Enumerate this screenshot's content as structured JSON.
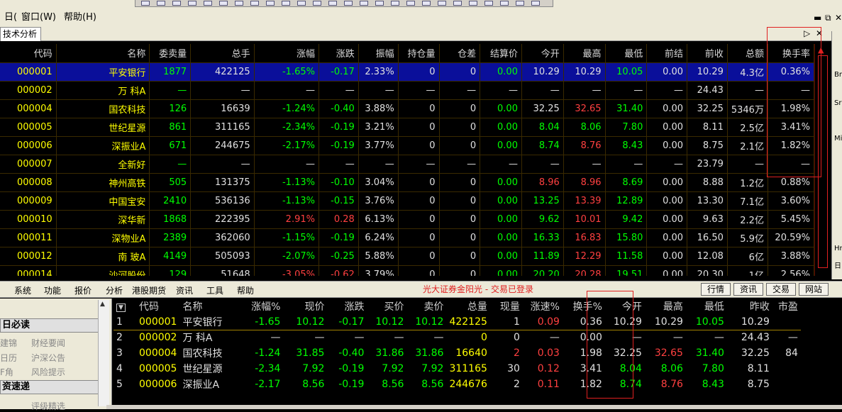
{
  "menubar": {
    "window_label": "窗口(W)",
    "help_label": "帮助(H)"
  },
  "tab": {
    "label": "技术分析"
  },
  "grid": {
    "headers": [
      "代码",
      "名称",
      "委卖量",
      "总手",
      "涨幅",
      "涨跌",
      "振幅",
      "持仓量",
      "仓差",
      "结算价",
      "今开",
      "最高",
      "最低",
      "前结",
      "前收",
      "总额",
      "换手率"
    ],
    "rows": [
      [
        "000001",
        "平安银行",
        "1877",
        "422125",
        "-1.65%",
        "-0.17",
        "2.33%",
        "0",
        "0",
        "0.00",
        "10.29",
        "10.29",
        "10.05",
        "0.00",
        "10.29",
        "4.3亿",
        "0.36%"
      ],
      [
        "000002",
        "万  科A",
        "—",
        "—",
        "—",
        "—",
        "—",
        "—",
        "—",
        "—",
        "—",
        "—",
        "—",
        "—",
        "24.43",
        "—",
        "—"
      ],
      [
        "000004",
        "国农科技",
        "126",
        "16639",
        "-1.24%",
        "-0.40",
        "3.88%",
        "0",
        "0",
        "0.00",
        "32.25",
        "32.65",
        "31.40",
        "0.00",
        "32.25",
        "5346万",
        "1.98%"
      ],
      [
        "000005",
        "世纪星源",
        "861",
        "311165",
        "-2.34%",
        "-0.19",
        "3.21%",
        "0",
        "0",
        "0.00",
        "8.04",
        "8.06",
        "7.80",
        "0.00",
        "8.11",
        "2.5亿",
        "3.41%"
      ],
      [
        "000006",
        "深振业A",
        "671",
        "244675",
        "-2.17%",
        "-0.19",
        "3.77%",
        "0",
        "0",
        "0.00",
        "8.74",
        "8.76",
        "8.43",
        "0.00",
        "8.75",
        "2.1亿",
        "1.82%"
      ],
      [
        "000007",
        "全新好",
        "—",
        "—",
        "—",
        "—",
        "—",
        "—",
        "—",
        "—",
        "—",
        "—",
        "—",
        "—",
        "23.79",
        "—",
        "—"
      ],
      [
        "000008",
        "神州高铁",
        "505",
        "131375",
        "-1.13%",
        "-0.10",
        "3.04%",
        "0",
        "0",
        "0.00",
        "8.96",
        "8.96",
        "8.69",
        "0.00",
        "8.88",
        "1.2亿",
        "0.88%"
      ],
      [
        "000009",
        "中国宝安",
        "2410",
        "536136",
        "-1.13%",
        "-0.15",
        "3.76%",
        "0",
        "0",
        "0.00",
        "13.25",
        "13.39",
        "12.89",
        "0.00",
        "13.30",
        "7.1亿",
        "3.60%"
      ],
      [
        "000010",
        "深华新",
        "1868",
        "222395",
        "2.91%",
        "0.28",
        "6.13%",
        "0",
        "0",
        "0.00",
        "9.62",
        "10.01",
        "9.42",
        "0.00",
        "9.63",
        "2.2亿",
        "5.45%"
      ],
      [
        "000011",
        "深物业A",
        "2389",
        "362060",
        "-1.15%",
        "-0.19",
        "6.24%",
        "0",
        "0",
        "0.00",
        "16.33",
        "16.83",
        "15.80",
        "0.00",
        "16.50",
        "5.9亿",
        "20.59%"
      ],
      [
        "000012",
        "南  玻A",
        "4149",
        "505093",
        "-2.07%",
        "-0.25",
        "5.88%",
        "0",
        "0",
        "0.00",
        "11.89",
        "12.29",
        "11.58",
        "0.00",
        "12.08",
        "6亿",
        "3.88%"
      ],
      [
        "000014",
        "沙河股份",
        "129",
        "51648",
        "-3.05%",
        "-0.62",
        "3.79%",
        "0",
        "0",
        "0.00",
        "20.20",
        "20.28",
        "19.51",
        "0.00",
        "20.30",
        "1亿",
        "2.56%"
      ]
    ],
    "colors": [
      [
        "y",
        "y",
        "g",
        "w",
        "g",
        "g",
        "w",
        "w",
        "w",
        "g",
        "w",
        "w",
        "g",
        "w",
        "w",
        "w",
        "w"
      ],
      [
        "y",
        "y",
        "g",
        "w",
        "w",
        "w",
        "w",
        "w",
        "w",
        "w",
        "w",
        "w",
        "w",
        "w",
        "w",
        "w",
        "w"
      ],
      [
        "y",
        "y",
        "g",
        "w",
        "g",
        "g",
        "w",
        "w",
        "w",
        "g",
        "w",
        "r",
        "g",
        "w",
        "w",
        "w",
        "w"
      ],
      [
        "y",
        "y",
        "g",
        "w",
        "g",
        "g",
        "w",
        "w",
        "w",
        "g",
        "g",
        "g",
        "g",
        "w",
        "w",
        "w",
        "w"
      ],
      [
        "y",
        "y",
        "g",
        "w",
        "g",
        "g",
        "w",
        "w",
        "w",
        "g",
        "g",
        "r",
        "g",
        "w",
        "w",
        "w",
        "w"
      ],
      [
        "y",
        "y",
        "g",
        "w",
        "w",
        "w",
        "w",
        "w",
        "w",
        "w",
        "w",
        "w",
        "w",
        "w",
        "w",
        "w",
        "w"
      ],
      [
        "y",
        "y",
        "g",
        "w",
        "g",
        "g",
        "w",
        "w",
        "w",
        "g",
        "r",
        "r",
        "g",
        "w",
        "w",
        "w",
        "w"
      ],
      [
        "y",
        "y",
        "g",
        "w",
        "g",
        "g",
        "w",
        "w",
        "w",
        "g",
        "g",
        "r",
        "g",
        "w",
        "w",
        "w",
        "w"
      ],
      [
        "y",
        "y",
        "g",
        "w",
        "r",
        "r",
        "w",
        "w",
        "w",
        "g",
        "g",
        "r",
        "g",
        "w",
        "w",
        "w",
        "w"
      ],
      [
        "y",
        "y",
        "g",
        "w",
        "g",
        "g",
        "w",
        "w",
        "w",
        "g",
        "g",
        "r",
        "g",
        "w",
        "w",
        "w",
        "w"
      ],
      [
        "y",
        "y",
        "g",
        "w",
        "g",
        "g",
        "w",
        "w",
        "w",
        "g",
        "g",
        "r",
        "g",
        "w",
        "w",
        "w",
        "w"
      ],
      [
        "y",
        "y",
        "g",
        "w",
        "r",
        "r",
        "w",
        "w",
        "w",
        "g",
        "g",
        "r",
        "g",
        "w",
        "w",
        "w",
        "w"
      ]
    ]
  },
  "menu2": {
    "items": [
      "系统",
      "功能",
      "报价",
      "分析",
      "港股期货",
      "资讯",
      "工具",
      "帮助"
    ],
    "status": "光大证券金阳光 - 交易已登录",
    "right_buttons": [
      "行情",
      "资讯",
      "交易",
      "网站"
    ]
  },
  "left": {
    "header1": "日必读",
    "items": [
      "建锦",
      "财经要闻",
      "日历",
      "沪深公告",
      "F角",
      "风险提示"
    ],
    "header2": "资速递",
    "item_last": "评级精选"
  },
  "bottom": {
    "headers": [
      "",
      "代码",
      "名称",
      "涨幅%",
      "现价",
      "涨跌",
      "买价",
      "卖价",
      "总量",
      "现量",
      "涨速%",
      "换手%",
      "今开",
      "最高",
      "最低",
      "昨收",
      "市盈"
    ],
    "rows": [
      [
        "1",
        "000001",
        "平安银行",
        "-1.65",
        "10.12",
        "-0.17",
        "10.12",
        "10.12",
        "422125",
        "1",
        "0.09",
        "0.36",
        "10.29",
        "10.29",
        "10.05",
        "10.29",
        ""
      ],
      [
        "2",
        "000002",
        "万  科A",
        "—",
        "—",
        "—",
        "—",
        "—",
        "0",
        "0",
        "—",
        "0.00",
        "—",
        "—",
        "—",
        "24.43",
        "—"
      ],
      [
        "3",
        "000004",
        "国农科技",
        "-1.24",
        "31.85",
        "-0.40",
        "31.86",
        "31.86",
        "16640",
        "2",
        "0.03",
        "1.98",
        "32.25",
        "32.65",
        "31.40",
        "32.25",
        "84"
      ],
      [
        "4",
        "000005",
        "世纪星源",
        "-2.34",
        "7.92",
        "-0.19",
        "7.92",
        "7.92",
        "311165",
        "30",
        "0.12",
        "3.41",
        "8.04",
        "8.06",
        "7.80",
        "8.11",
        ""
      ],
      [
        "5",
        "000006",
        "深振业A",
        "-2.17",
        "8.56",
        "-0.19",
        "8.56",
        "8.56",
        "244676",
        "2",
        "0.11",
        "1.82",
        "8.74",
        "8.76",
        "8.43",
        "8.75",
        ""
      ]
    ],
    "colors": [
      [
        "w",
        "y",
        "w",
        "g",
        "g",
        "g",
        "g",
        "g",
        "y",
        "w",
        "r",
        "w",
        "w",
        "w",
        "g",
        "w",
        "w"
      ],
      [
        "w",
        "y",
        "w",
        "w",
        "w",
        "w",
        "w",
        "w",
        "y",
        "w",
        "w",
        "w",
        "w",
        "w",
        "w",
        "w",
        "w"
      ],
      [
        "w",
        "y",
        "w",
        "g",
        "g",
        "g",
        "g",
        "g",
        "y",
        "r",
        "r",
        "w",
        "w",
        "r",
        "g",
        "w",
        "w"
      ],
      [
        "w",
        "y",
        "w",
        "g",
        "g",
        "g",
        "g",
        "g",
        "y",
        "w",
        "r",
        "w",
        "g",
        "g",
        "g",
        "w",
        "w"
      ],
      [
        "w",
        "y",
        "w",
        "g",
        "g",
        "g",
        "g",
        "g",
        "y",
        "w",
        "r",
        "w",
        "g",
        "r",
        "g",
        "w",
        "w"
      ]
    ]
  },
  "right_panel": [
    "Br",
    "Sr",
    "Mi",
    "Hr",
    "日"
  ]
}
